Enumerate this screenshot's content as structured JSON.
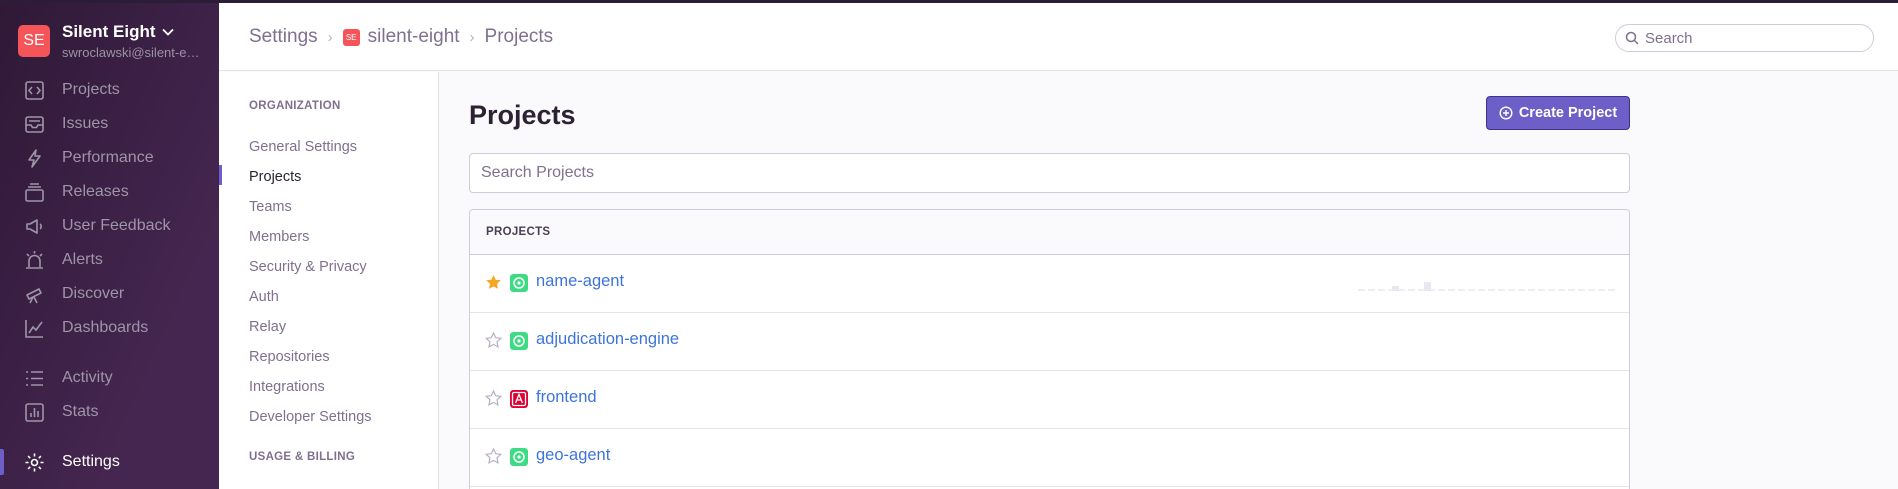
{
  "org": {
    "initials": "SE",
    "name": "Silent Eight",
    "email": "swroclawski@silent-eight.com"
  },
  "sidebar": {
    "items": [
      {
        "label": "Projects",
        "icon": "code-brackets-icon"
      },
      {
        "label": "Issues",
        "icon": "inbox-icon"
      },
      {
        "label": "Performance",
        "icon": "lightning-icon"
      },
      {
        "label": "Releases",
        "icon": "package-icon"
      },
      {
        "label": "User Feedback",
        "icon": "megaphone-icon"
      },
      {
        "label": "Alerts",
        "icon": "siren-icon"
      },
      {
        "label": "Discover",
        "icon": "telescope-icon"
      },
      {
        "label": "Dashboards",
        "icon": "graph-icon"
      },
      {
        "label": "Activity",
        "icon": "list-icon"
      },
      {
        "label": "Stats",
        "icon": "bar-chart-icon"
      },
      {
        "label": "Settings",
        "icon": "gear-icon"
      }
    ],
    "active": "Settings"
  },
  "header": {
    "breadcrumbs": [
      {
        "label": "Settings"
      },
      {
        "label": "silent-eight",
        "badge": "SE"
      },
      {
        "label": "Projects"
      }
    ],
    "search_placeholder": "Search"
  },
  "subnav": {
    "organization_title": "ORGANIZATION",
    "items": [
      "General Settings",
      "Projects",
      "Teams",
      "Members",
      "Security & Privacy",
      "Auth",
      "Relay",
      "Repositories",
      "Integrations",
      "Developer Settings"
    ],
    "active": "Projects",
    "billing_title": "USAGE & BILLING"
  },
  "main": {
    "title": "Projects",
    "create_button": "Create Project",
    "search_placeholder": "Search Projects",
    "panel_title": "PROJECTS",
    "projects": [
      {
        "name": "name-agent",
        "starred": true,
        "platform": "android",
        "platform_color": "#3ddc84"
      },
      {
        "name": "adjudication-engine",
        "starred": false,
        "platform": "android",
        "platform_color": "#3ddc84"
      },
      {
        "name": "frontend",
        "starred": false,
        "platform": "angular",
        "platform_color": "#dd0031"
      },
      {
        "name": "geo-agent",
        "starred": false,
        "platform": "android",
        "platform_color": "#3ddc84"
      }
    ]
  },
  "colors": {
    "accent": "#6c5fc7",
    "link": "#3d74db",
    "star": "#f5a623"
  }
}
